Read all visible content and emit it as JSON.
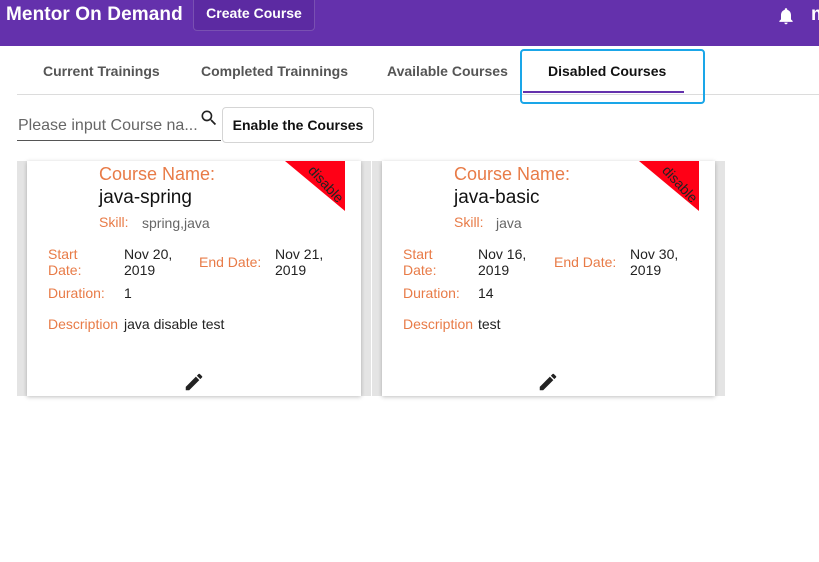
{
  "header": {
    "brand": "Mentor On Demand",
    "create_course": "Create Course",
    "user_initial": "m"
  },
  "tabs": [
    {
      "label": "Current Trainings"
    },
    {
      "label": "Completed Trainnings"
    },
    {
      "label": "Available Courses"
    },
    {
      "label": "Disabled Courses",
      "active": true
    }
  ],
  "search": {
    "placeholder": "Please input Course na...",
    "value": "",
    "enable_button": "Enable the Courses"
  },
  "labels": {
    "course_name": "Course Name:",
    "skill": "Skill:",
    "start_date": "Start Date:",
    "end_date": "End Date:",
    "duration": "Duration:",
    "description": "Description"
  },
  "cards": [
    {
      "name": "java-spring",
      "skill": "spring,java",
      "start_date": "Nov 20, 2019",
      "end_date": "Nov 21, 2019",
      "duration": "1",
      "description": "java disable test",
      "ribbon": "disable"
    },
    {
      "name": "java-basic",
      "skill": "java",
      "start_date": "Nov 16, 2019",
      "end_date": "Nov 30, 2019",
      "duration": "14",
      "description": "test",
      "ribbon": "disable"
    }
  ],
  "colors": {
    "primary": "#6431ac",
    "accent_label": "#e87b47",
    "ribbon": "#ff0016",
    "focus": "#1aa6e8"
  }
}
